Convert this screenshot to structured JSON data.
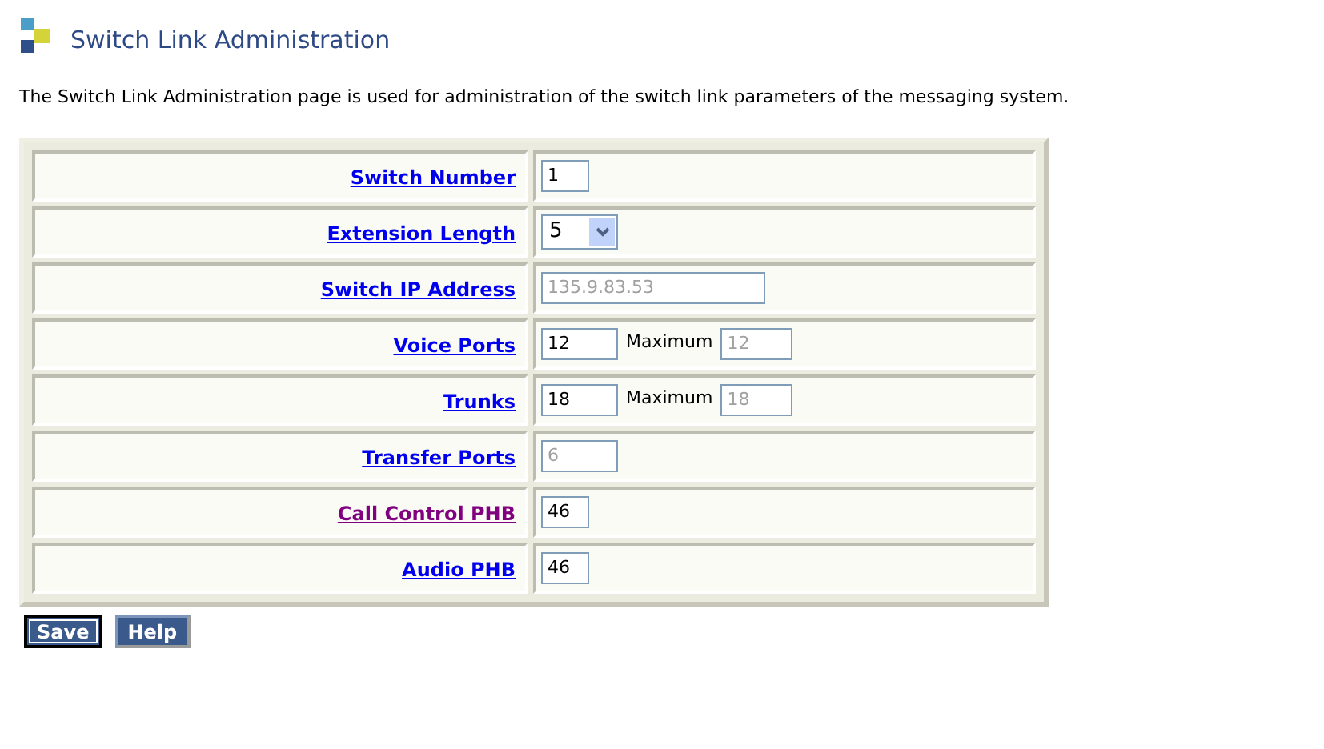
{
  "title": "Switch Link Administration",
  "description": "The Switch Link Administration page is used for administration of the switch link parameters of the messaging system.",
  "rows": [
    {
      "label": "Switch Number",
      "visited": false,
      "field": {
        "kind": "text",
        "value": "1",
        "disabled": false
      }
    },
    {
      "label": "Extension Length",
      "visited": false,
      "field": {
        "kind": "select",
        "value": "5"
      }
    },
    {
      "label": "Switch IP Address",
      "visited": false,
      "field": {
        "kind": "text",
        "value": "135.9.83.53",
        "disabled": true
      }
    },
    {
      "label": "Voice Ports",
      "visited": false,
      "field": {
        "kind": "text",
        "value": "12",
        "disabled": false
      },
      "maximum": {
        "label": "Maximum",
        "value": "12",
        "disabled": true
      }
    },
    {
      "label": "Trunks",
      "visited": false,
      "field": {
        "kind": "text",
        "value": "18",
        "disabled": false
      },
      "maximum": {
        "label": "Maximum",
        "value": "18",
        "disabled": true
      }
    },
    {
      "label": "Transfer Ports",
      "visited": false,
      "field": {
        "kind": "text",
        "value": "6",
        "disabled": true
      }
    },
    {
      "label": "Call Control PHB",
      "visited": true,
      "field": {
        "kind": "text",
        "value": "46",
        "disabled": false
      }
    },
    {
      "label": "Audio PHB",
      "visited": false,
      "field": {
        "kind": "text",
        "value": "46",
        "disabled": false
      }
    }
  ],
  "buttons": [
    {
      "label": "Save",
      "focused": true
    },
    {
      "label": "Help",
      "focused": false
    }
  ]
}
